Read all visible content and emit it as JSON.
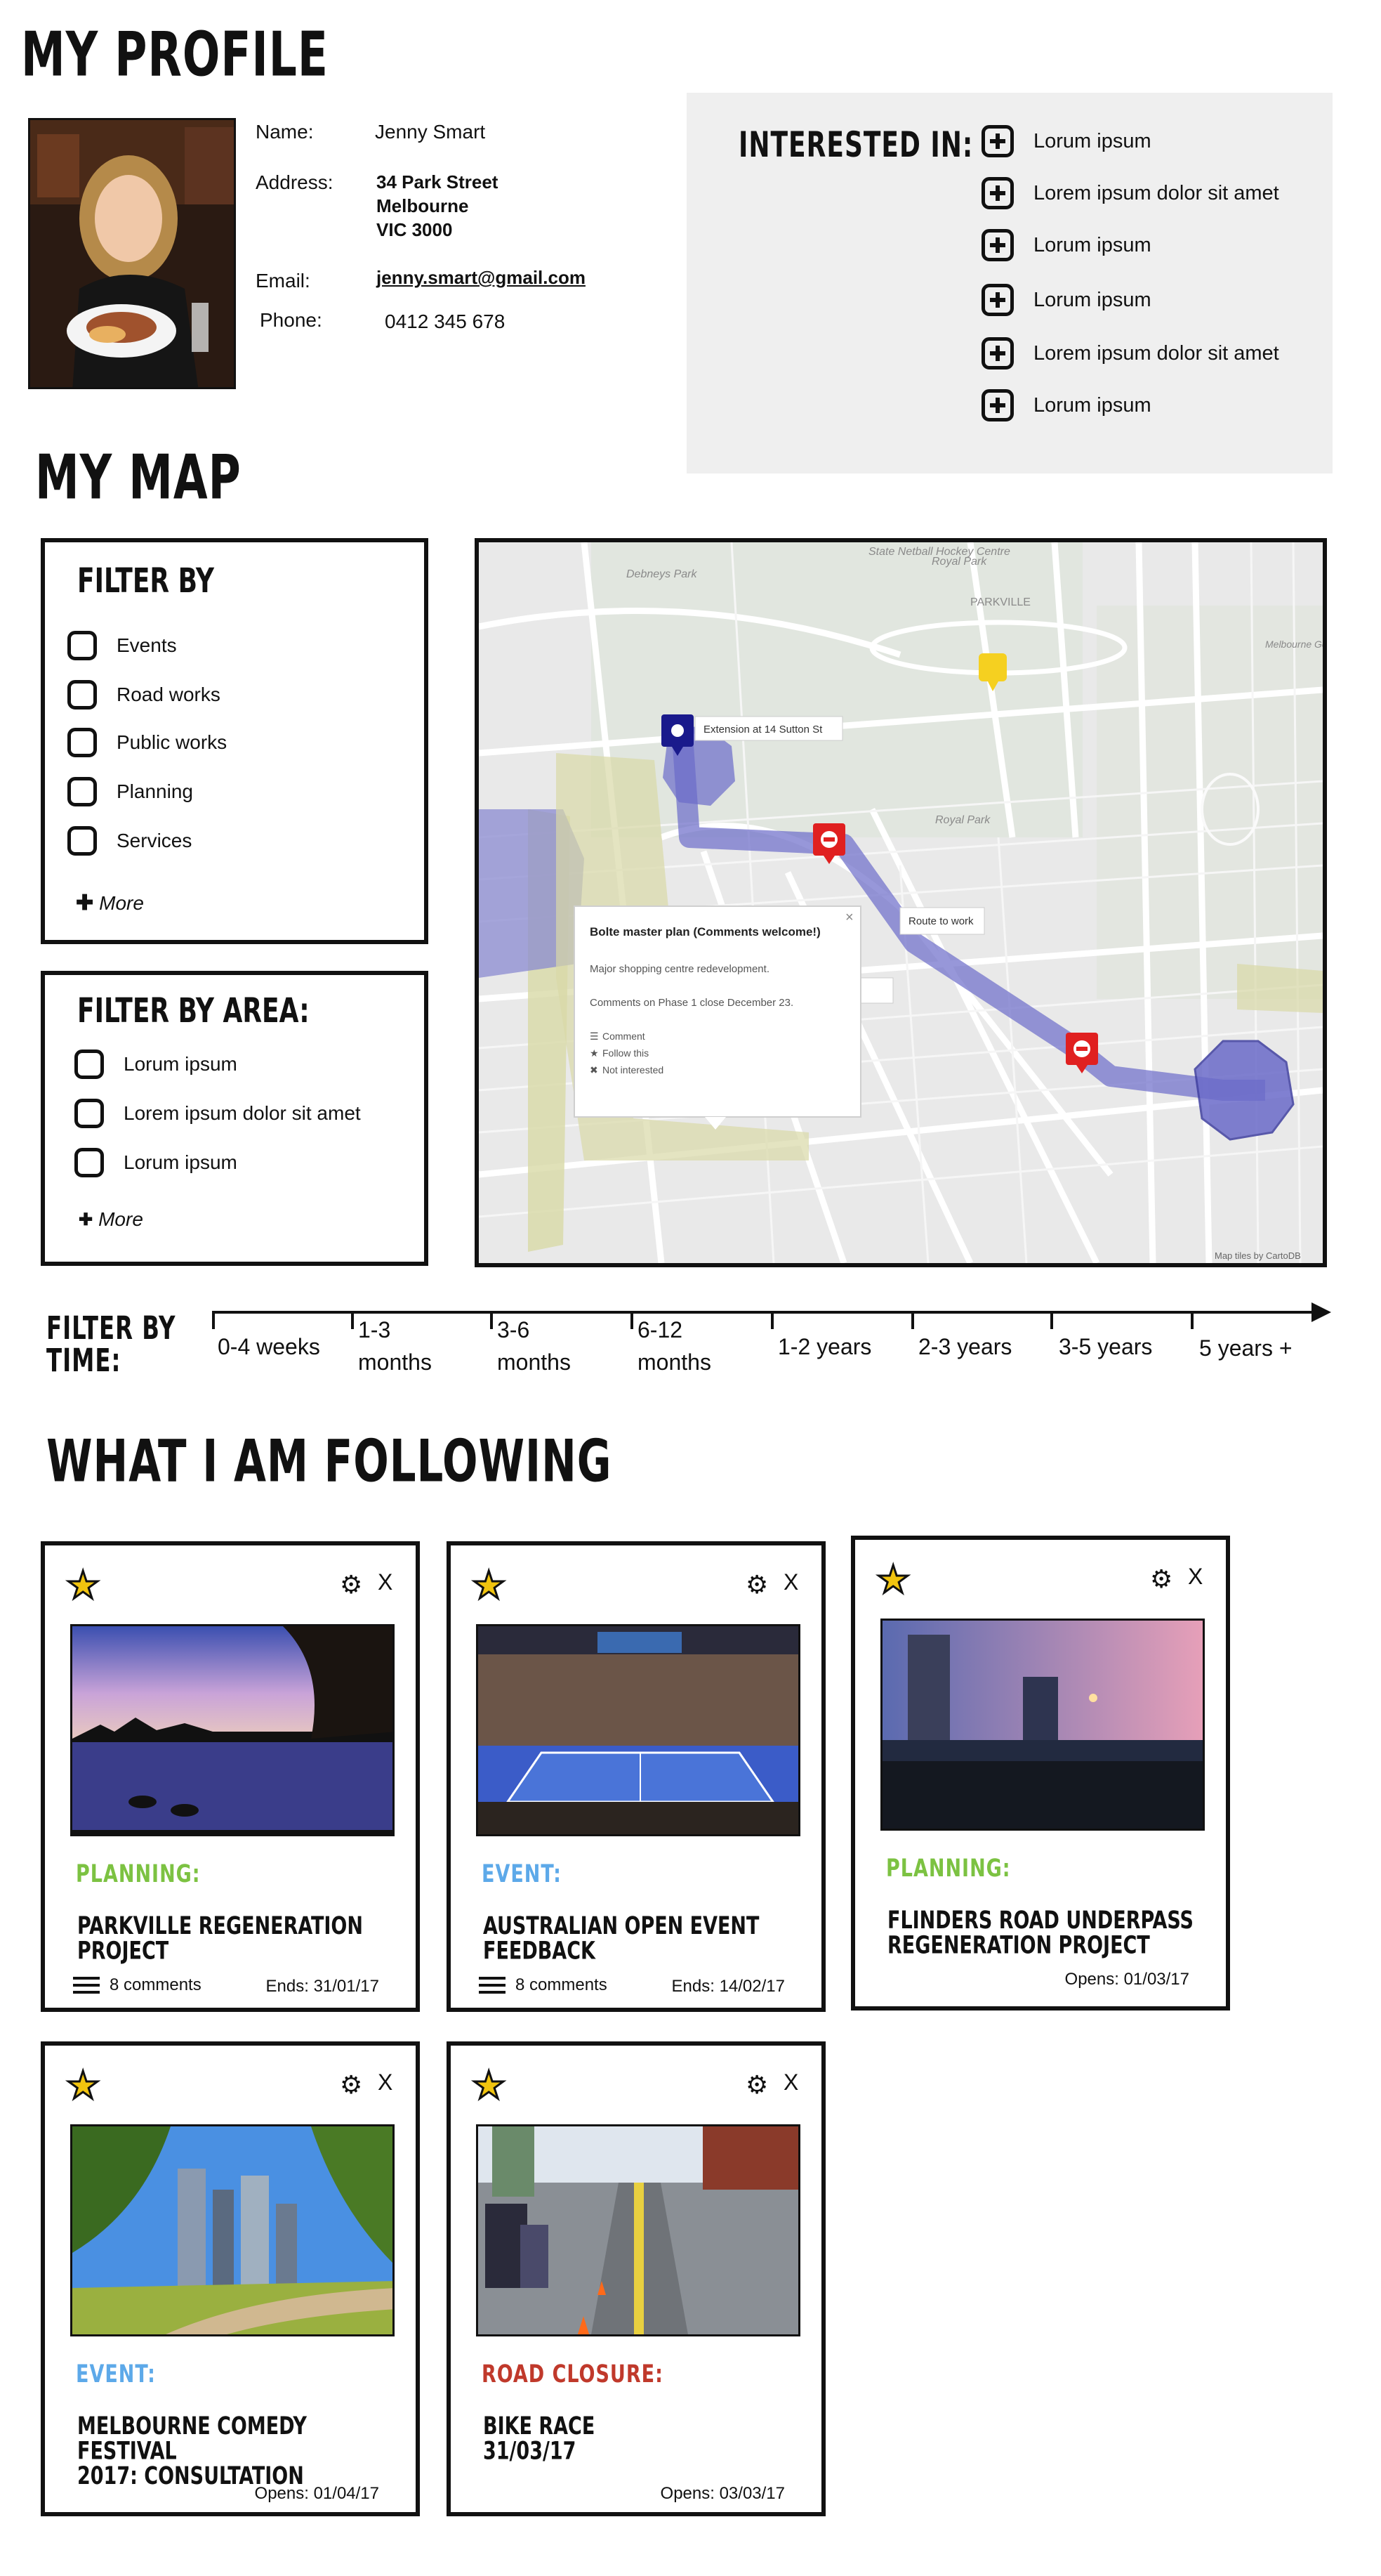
{
  "profile": {
    "heading": "MY PROFILE",
    "name_label": "Name:",
    "name": "Jenny Smart",
    "address_label": "Address:",
    "address_line1": "34 Park Street",
    "address_line2": "Melbourne",
    "address_line3": "VIC 3000",
    "email_label": "Email:",
    "email": "jenny.smart@gmail.com",
    "phone_label": "Phone:",
    "phone": "0412 345 678"
  },
  "interests": {
    "heading": "INTERESTED IN:",
    "items": [
      "Lorum ipsum",
      "Lorem ipsum dolor sit amet",
      "Lorum ipsum",
      "Lorum ipsum",
      "Lorem ipsum dolor sit amet",
      "Lorum ipsum"
    ]
  },
  "map_section": {
    "heading": "MY MAP",
    "filter_by": {
      "title": "FILTER BY",
      "options": [
        "Events",
        "Road works",
        "Public works",
        "Planning",
        "Services"
      ],
      "more": "More"
    },
    "filter_by_area": {
      "title": "FILTER BY AREA:",
      "options": [
        "Lorum ipsum",
        "Lorem ipsum dolor sit amet",
        "Lorum ipsum"
      ],
      "more": "More"
    },
    "map": {
      "places": [
        "Debneys Park",
        "State Netball Hockey Centre",
        "Royal Park",
        "PARKVILLE",
        "Melbourne General Cemetery",
        "Royal Park"
      ],
      "tooltip_extension": "Extension at 14 Sutton St",
      "tooltip_route": "Route to work",
      "popup": {
        "title": "Bolte master plan (Comments welcome!)",
        "desc": "Major shopping centre redevelopment.",
        "note": "Comments on Phase 1 close December 23.",
        "action_comment": "Comment",
        "action_follow": "Follow this",
        "action_not": "Not interested",
        "close": "×"
      },
      "attribution": "Map tiles by CartoDB"
    },
    "filter_by_time": {
      "title_line1": "FILTER BY",
      "title_line2": "TIME:",
      "ranges": [
        {
          "line1": "0-4 weeks",
          "line2": ""
        },
        {
          "line1": "1-3",
          "line2": "months"
        },
        {
          "line1": "3-6",
          "line2": "months"
        },
        {
          "line1": "6-12",
          "line2": "months"
        },
        {
          "line1": "1-2 years",
          "line2": ""
        },
        {
          "line1": "2-3 years",
          "line2": ""
        },
        {
          "line1": "3-5 years",
          "line2": ""
        },
        {
          "line1": "5 years +",
          "line2": ""
        }
      ]
    }
  },
  "following": {
    "heading": "WHAT I AM FOLLOWING",
    "cards": [
      {
        "category": "PLANNING:",
        "category_color": "#7cc242",
        "title_line1": "PARKVILLE REGENERATION",
        "title_line2": "PROJECT",
        "comments": "8 comments",
        "date": "Ends: 31/01/17",
        "photo": "lake-sunset"
      },
      {
        "category": "EVENT:",
        "category_color": "#5da9e9",
        "title_line1": "AUSTRALIAN OPEN EVENT",
        "title_line2": "FEEDBACK",
        "comments": "8 comments",
        "date": "Ends: 14/02/17",
        "photo": "tennis-arena"
      },
      {
        "category": "PLANNING:",
        "category_color": "#7cc242",
        "title_line1": "FLINDERS ROAD UNDERPASS",
        "title_line2": "REGENERATION PROJECT",
        "comments": "",
        "date": "Opens: 01/03/17",
        "photo": "bridge-dusk"
      },
      {
        "category": "EVENT:",
        "category_color": "#5da9e9",
        "title_line1": "MELBOURNE COMEDY FESTIVAL",
        "title_line2": "2017: CONSULTATION",
        "comments": "",
        "date": "Opens: 01/04/17",
        "photo": "city-river"
      },
      {
        "category": "ROAD CLOSURE:",
        "category_color": "#c0392b",
        "title_line1": "BIKE RACE",
        "title_line2": "31/03/17",
        "comments": "",
        "date": "Opens: 03/03/17",
        "photo": "bike-race"
      }
    ],
    "close_glyph": "X"
  },
  "colors": {
    "route": "#6b6bc9",
    "zone_yellow": "#d8d9a6",
    "marker_red": "#e02020",
    "marker_blue": "#1a1a8c",
    "marker_yellow": "#f5d020",
    "panel_bg": "#efefef"
  }
}
